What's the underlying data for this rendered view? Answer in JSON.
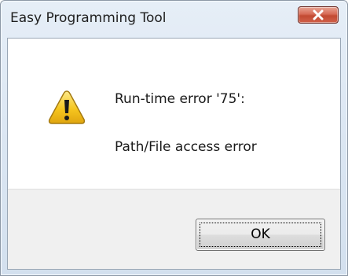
{
  "window": {
    "title": "Easy Programming Tool",
    "close_icon": "close-icon"
  },
  "message": {
    "icon": "warning-icon",
    "line1": "Run-time error '75':",
    "line2": "Path/File access error"
  },
  "buttons": {
    "ok_label": "OK"
  },
  "colors": {
    "close_button": "#c9503a",
    "warning_fill": "#f6c61f",
    "footer_background": "#f0f0f0",
    "title_text": "#1e1e1e"
  }
}
